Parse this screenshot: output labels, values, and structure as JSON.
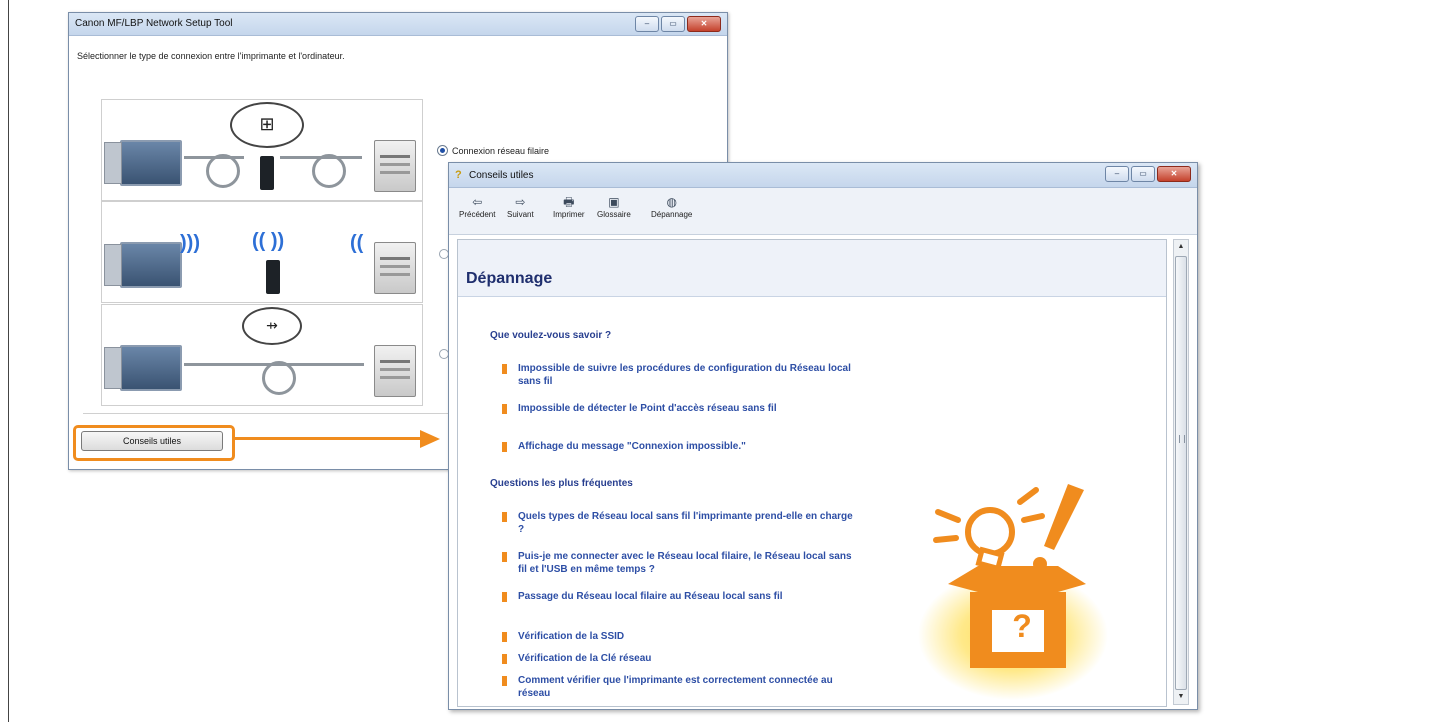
{
  "setup_window": {
    "title": "Canon MF/LBP Network Setup Tool",
    "instruction": "Sélectionner le type de connexion entre l'imprimante et l'ordinateur.",
    "option_wired": "Connexion réseau filaire",
    "tips_button": "Conseils utiles",
    "caption_buttons": {
      "minimize": "–",
      "maximize": "▭",
      "close": "✕"
    }
  },
  "help_window": {
    "title": "Conseils utiles",
    "toolbar": [
      {
        "label": "Précédent",
        "icon": "back-arrow-icon",
        "glyph": "⇦"
      },
      {
        "label": "Suivant",
        "icon": "forward-arrow-icon",
        "glyph": "⇨"
      },
      {
        "label": "Imprimer",
        "icon": "printer-icon",
        "glyph": "🖶"
      },
      {
        "label": "Glossaire",
        "icon": "glossary-document-icon",
        "glyph": "▣"
      },
      {
        "label": "Dépannage",
        "icon": "troubleshooting-globe-icon",
        "glyph": "◍"
      }
    ],
    "page_title": "Dépannage",
    "section1_title": "Que voulez-vous savoir ?",
    "section1_links": [
      "Impossible de suivre les procédures de configuration du Réseau local sans fil",
      "Impossible de détecter le Point d'accès réseau sans fil",
      "Affichage du message \"Connexion impossible.\""
    ],
    "section2_title": "Questions les plus fréquentes",
    "section2_links": [
      "Quels types de Réseau local sans fil l'imprimante prend-elle en charge ?",
      "Puis-je me connecter avec le Réseau local filaire, le Réseau local sans fil et l'USB en même temps ?",
      "Passage du Réseau local filaire au Réseau local sans fil",
      "Vérification de la SSID",
      "Vérification de la Clé réseau",
      "Comment vérifier que l'imprimante est correctement connectée au réseau"
    ],
    "illustration_mark": "?",
    "accent_color": "#f08c1e"
  }
}
